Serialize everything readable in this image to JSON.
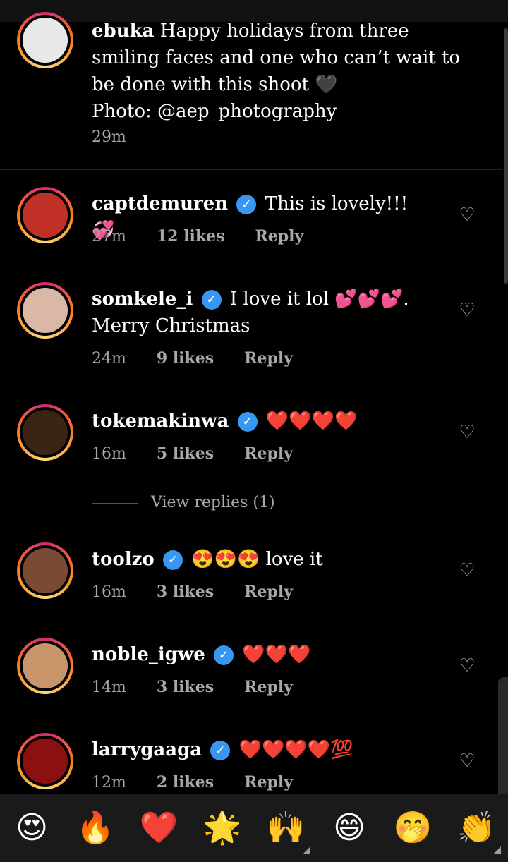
{
  "caption": {
    "username": "ebuka",
    "text": "Happy holidays from three smiling faces and one who can’t wait to be done with this shoot 🖤",
    "photo_credit": "Photo: @aep_photography",
    "time": "29m"
  },
  "comments": [
    {
      "username": "captdemuren",
      "text": "This is lovely!!!💞",
      "time": "27m",
      "likes": "12 likes",
      "reply": "Reply",
      "avatar_color": "#c03027"
    },
    {
      "username": "somkele_i",
      "text": "I love it lol 💕💕💕. Merry Christmas",
      "time": "24m",
      "likes": "9 likes",
      "reply": "Reply",
      "avatar_color": "#d9b8a6"
    },
    {
      "username": "tokemakinwa",
      "text": "❤️❤️❤️❤️",
      "time": "16m",
      "likes": "5 likes",
      "reply": "Reply",
      "avatar_color": "#3b2413"
    },
    {
      "username": "toolzo",
      "text": "😍😍😍 love it",
      "time": "16m",
      "likes": "3 likes",
      "reply": "Reply",
      "avatar_color": "#7a4a35"
    },
    {
      "username": "noble_igwe",
      "text": "❤️❤️❤️",
      "time": "14m",
      "likes": "3 likes",
      "reply": "Reply",
      "avatar_color": "#c8956a"
    },
    {
      "username": "larrygaaga",
      "text": "❤️❤️❤️❤️💯",
      "time": "12m",
      "likes": "2 likes",
      "reply": "Reply",
      "avatar_color": "#8b1010"
    }
  ],
  "view_replies": "View replies (1)",
  "verified_icon": "✓",
  "heart_icon": "♡",
  "emoji_bar": [
    "😍",
    "🔥",
    "❤️",
    "🌟",
    "🙌",
    "😄",
    "🤭",
    "👏"
  ]
}
